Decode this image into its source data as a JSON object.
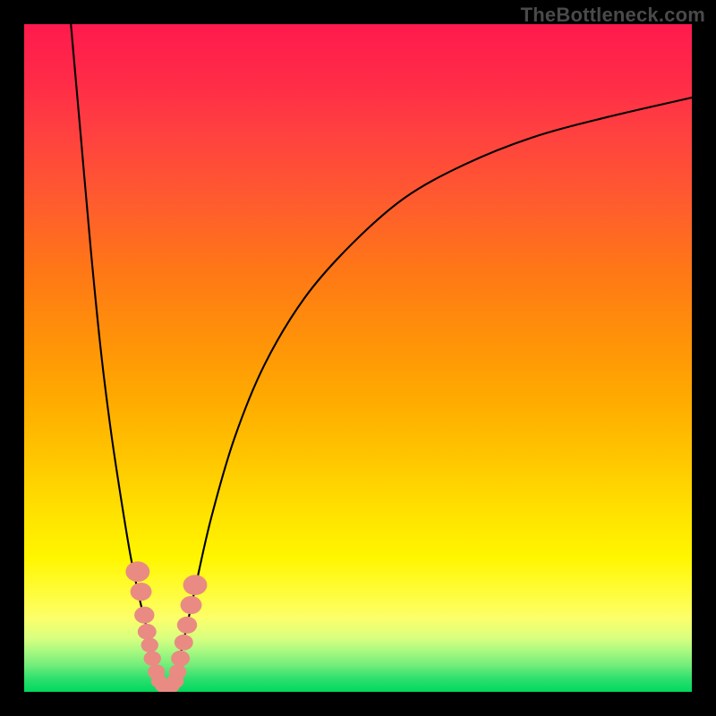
{
  "watermark": "TheBottleneck.com",
  "chart_data": {
    "type": "line",
    "title": "",
    "xlabel": "",
    "ylabel": "",
    "xlim": [
      0,
      100
    ],
    "ylim": [
      0,
      100
    ],
    "grid": false,
    "series": [
      {
        "name": "bottleneck-curve-left",
        "x": [
          7.0,
          8.5,
          10.0,
          11.5,
          13.0,
          14.5,
          16.0,
          17.5,
          19.0,
          20.0,
          20.8
        ],
        "y": [
          100,
          83,
          66,
          51,
          39,
          29,
          20,
          13,
          7,
          3,
          0.5
        ]
      },
      {
        "name": "bottleneck-curve-right",
        "x": [
          22.0,
          23.5,
          25.5,
          28.0,
          31.5,
          36.0,
          42.0,
          49.0,
          57.0,
          66.0,
          76.0,
          87.0,
          100.0
        ],
        "y": [
          0.5,
          6,
          15,
          26,
          38,
          49,
          59,
          67,
          74,
          79,
          83,
          86,
          89
        ]
      }
    ],
    "markers": {
      "name": "highlight-dots",
      "color": "#e98b83",
      "points": [
        {
          "x": 17.0,
          "y": 18.0,
          "r": 1.8
        },
        {
          "x": 17.5,
          "y": 15.0,
          "r": 1.6
        },
        {
          "x": 18.0,
          "y": 11.5,
          "r": 1.5
        },
        {
          "x": 18.4,
          "y": 9.0,
          "r": 1.4
        },
        {
          "x": 18.8,
          "y": 7.0,
          "r": 1.3
        },
        {
          "x": 19.2,
          "y": 5.0,
          "r": 1.3
        },
        {
          "x": 19.8,
          "y": 3.0,
          "r": 1.3
        },
        {
          "x": 20.2,
          "y": 1.6,
          "r": 1.2
        },
        {
          "x": 20.8,
          "y": 0.9,
          "r": 1.2
        },
        {
          "x": 21.4,
          "y": 0.8,
          "r": 1.2
        },
        {
          "x": 22.0,
          "y": 0.9,
          "r": 1.3
        },
        {
          "x": 22.6,
          "y": 1.6,
          "r": 1.3
        },
        {
          "x": 23.0,
          "y": 3.0,
          "r": 1.3
        },
        {
          "x": 23.4,
          "y": 5.0,
          "r": 1.4
        },
        {
          "x": 23.9,
          "y": 7.4,
          "r": 1.4
        },
        {
          "x": 24.4,
          "y": 10.0,
          "r": 1.5
        },
        {
          "x": 25.0,
          "y": 13.0,
          "r": 1.6
        },
        {
          "x": 25.6,
          "y": 16.0,
          "r": 1.8
        }
      ]
    }
  }
}
